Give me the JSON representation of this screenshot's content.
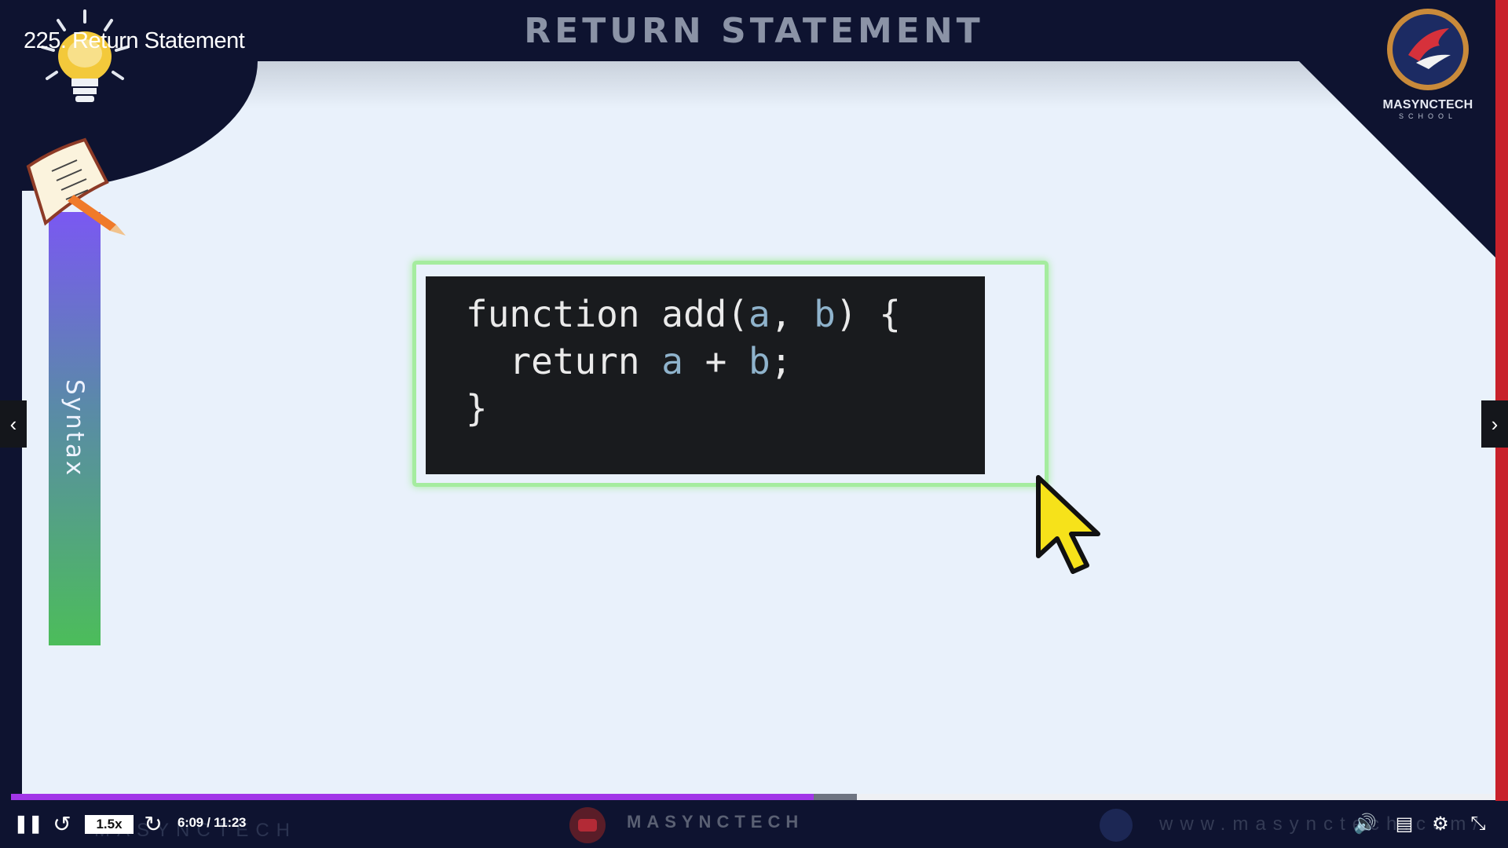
{
  "video": {
    "title": "225. Return Statement"
  },
  "slide": {
    "heading": "RETURN STATEMENT",
    "sidebar_label": "Syntax",
    "code": {
      "line1_kw": "function add(",
      "line1_a": "a",
      "line1_sep": ", ",
      "line1_b": "b",
      "line1_end": ") {",
      "line2_kw": "  return ",
      "line2_a": "a",
      "line2_op": " + ",
      "line2_b": "b",
      "line2_end": ";",
      "line3": "}"
    },
    "logo": {
      "name": "MASYNCTECH",
      "sub": "SCHOOL"
    }
  },
  "player": {
    "speed_label": "1.5x",
    "time_display": "6:09 / 11:23",
    "progress_fraction": 0.541,
    "buffered_fraction": 0.57,
    "prev_icon": "‹",
    "next_icon": "›",
    "pause_icon": "❚❚",
    "replay_icon": "↺",
    "forward_icon": "↻",
    "volume_icon": "🔊",
    "captions_icon": "▤",
    "settings_icon": "⚙",
    "fullscreen_icon": "⤡"
  },
  "watermark": {
    "left": "MASYNCTECH",
    "center": "MASYNCTECH",
    "url": "www.masynctech.com/"
  },
  "colors": {
    "progress": "#a236e8",
    "code_frame": "#a5ec9f",
    "accent_red": "#c8212b"
  }
}
